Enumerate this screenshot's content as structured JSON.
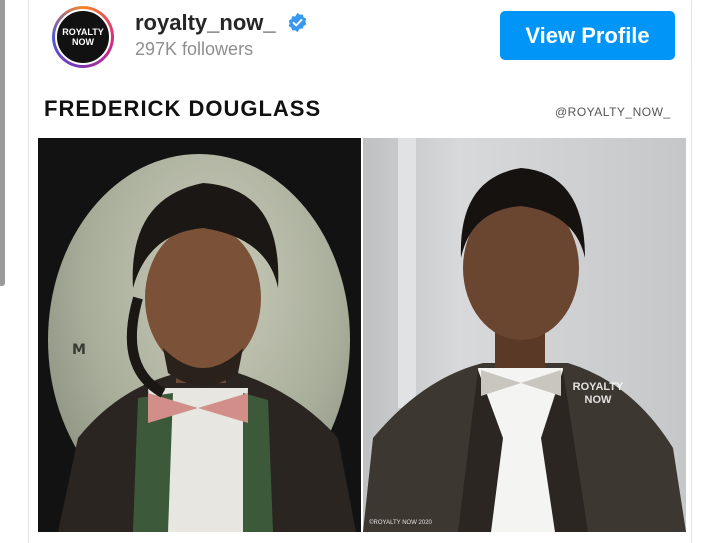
{
  "profile": {
    "avatar_line1": "ROYALTY",
    "avatar_line2": "NOW",
    "username": "royalty_now_",
    "followers": "297K followers",
    "view_profile_label": "View Profile"
  },
  "post": {
    "title": "FREDERICK DOUGLASS",
    "handle": "@ROYALTY_NOW_"
  },
  "watermarks": {
    "right_line1": "ROYALTY",
    "right_line2": "NOW",
    "right_footer": "©ROYALTY NOW 2020"
  },
  "colors": {
    "button_blue": "#0095f6",
    "verified_blue": "#3897f0"
  }
}
